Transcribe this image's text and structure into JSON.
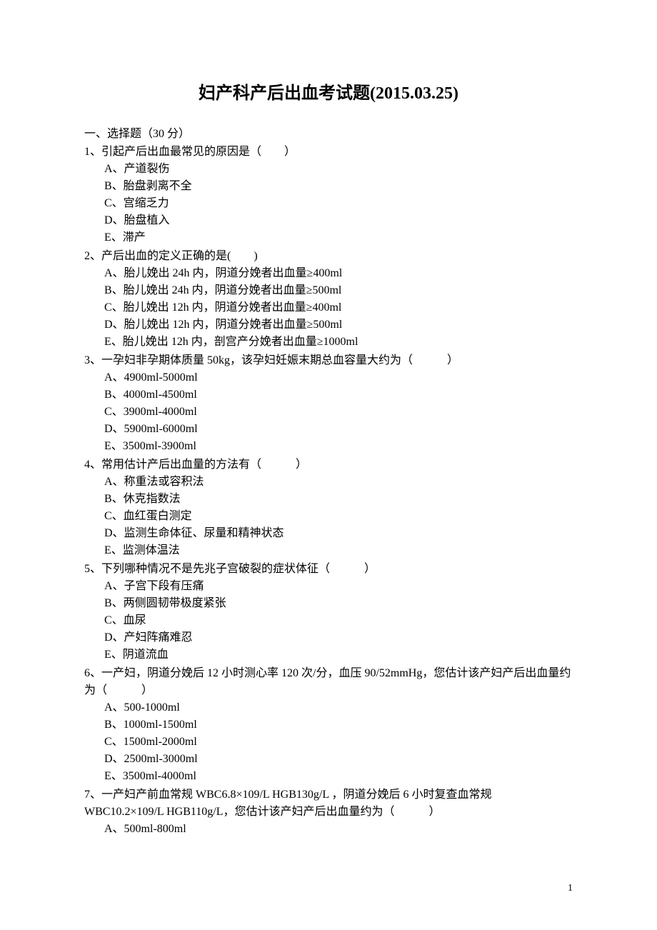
{
  "title": "妇产科产后出血考试题(2015.03.25)",
  "section1": {
    "header": "一、选择题（30 分）"
  },
  "q1": {
    "stem": "1、引起产后出血最常见的原因是（　　）",
    "a": "A、产道裂伤",
    "b": "B、胎盘剥离不全",
    "c": "C、宫缩乏力",
    "d": "D、胎盘植入",
    "e": "E、滞产"
  },
  "q2": {
    "stem": "2、产后出血的定义正确的是(　　)",
    "a": "A、胎儿娩出 24h 内，阴道分娩者出血量≥400ml",
    "b": "B、胎儿娩出 24h 内，阴道分娩者出血量≥500ml",
    "c": "C、胎儿娩出 12h 内，阴道分娩者出血量≥400ml",
    "d": "D、胎儿娩出 12h 内，阴道分娩者出血量≥500ml",
    "e": "E、胎儿娩出 12h 内，剖宫产分娩者出血量≥1000ml"
  },
  "q3": {
    "stem": "3、一孕妇非孕期体质量 50kg，该孕妇妊娠末期总血容量大约为（　　　）",
    "a": "A、4900ml-5000ml",
    "b": "B、4000ml-4500ml",
    "c": "C、3900ml-4000ml",
    "d": "D、5900ml-6000ml",
    "e": "E、3500ml-3900ml"
  },
  "q4": {
    "stem": "4、常用估计产后出血量的方法有（　　　）",
    "a": "A、称重法或容积法",
    "b": "B、休克指数法",
    "c": "C、血红蛋白测定",
    "d": "D、监测生命体征、尿量和精神状态",
    "e": "E、监测体温法"
  },
  "q5": {
    "stem": "5、下列哪种情况不是先兆子宫破裂的症状体征（　　　）",
    "a": "A、子宫下段有压痛",
    "b": "B、两侧圆韧带极度紧张",
    "c": "C、血尿",
    "d": "D、产妇阵痛难忍",
    "e": "E、阴道流血"
  },
  "q6": {
    "stem": "6、一产妇，阴道分娩后 12 小时测心率 120 次/分，血压 90/52mmHg，您估计该产妇产后出血量约为（　　　）",
    "a": "A、500-1000ml",
    "b": "B、1000ml-1500ml",
    "c": "C、1500ml-2000ml",
    "d": "D、2500ml-3000ml",
    "e": "E、3500ml-4000ml"
  },
  "q7": {
    "stem": "7、一产妇产前血常规 WBC6.8×109/L HGB130g/L ，阴道分娩后 6 小时复查血常规 WBC10.2×109/L HGB110g/L，您估计该产妇产后出血量约为（　　　）",
    "a": "A、500ml-800ml"
  },
  "pageNumber": "1"
}
